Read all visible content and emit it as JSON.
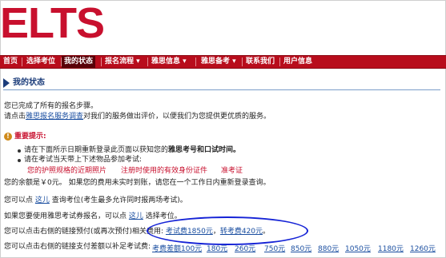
{
  "logo": {
    "text": "IELTS"
  },
  "nav": [
    {
      "label": "首页"
    },
    {
      "label": "选择考位"
    },
    {
      "label": "我的状态"
    },
    {
      "label": "报名流程 ▾"
    },
    {
      "label": "雅思信息 ▾"
    },
    {
      "label": "雅思备考 ▾"
    },
    {
      "label": "联系我们"
    },
    {
      "label": "用户信息"
    }
  ],
  "page_title": "我的状态",
  "completed": "您已完成了所有的报名步骤。",
  "survey": {
    "prefix": "请点击",
    "link": "雅思报名服务调查",
    "suffix": "对我们的服务做出评价，以便我们为您提供更优质的服务。"
  },
  "notice": {
    "icon": "exclamation-icon",
    "title": "重要提示:",
    "item1_prefix": "请在下面所示日期重新登录此页面以获知您的",
    "item1_bold": "雅思考号和口试时间。",
    "item2": "请在考试当天带上下述物品参加考试:",
    "reqs": [
      "您的护照规格的近期照片",
      "注册时使用的有效身份证件",
      "准考证"
    ]
  },
  "balance": "您的余额是￥0元。 如果您的费用未实时到账，请您在一个工作日内重新登录查询。",
  "check_seat": {
    "prefix": "您可以点",
    "link": "这儿",
    "suffix": "查询考位(考生最多允许同时报两场考试)。"
  },
  "retake": {
    "prefix": "如果您要使用雅思考试券报名，可以点",
    "link": "这儿",
    "suffix": "选择考位。"
  },
  "payment": {
    "text": "您可以点击右侧的链接预付(或再次预付)相关费用:",
    "links": [
      "考试费1850元",
      "转考费420元"
    ]
  },
  "supplement": {
    "text": "您可以点击右侧的链接支付差额以补足考试费:",
    "links": [
      "考费差额100元",
      "180元",
      "260元",
      "750元",
      "850元",
      "880元",
      "1050元",
      "1180元",
      "1260元"
    ]
  }
}
